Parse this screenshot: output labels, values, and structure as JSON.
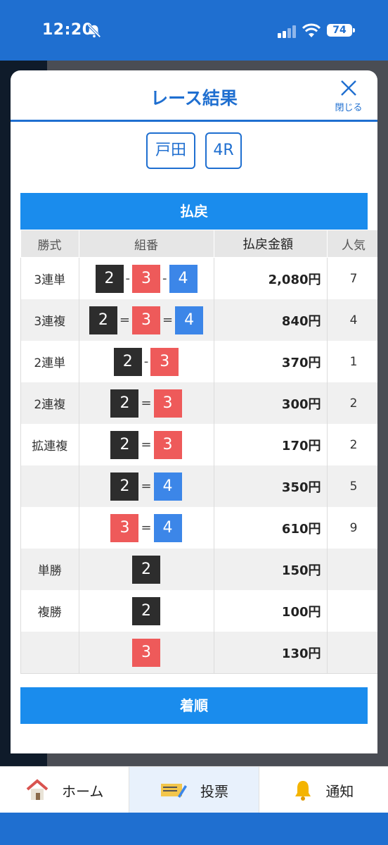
{
  "status": {
    "time": "12:20",
    "battery": "74"
  },
  "modal": {
    "title": "レース結果",
    "close_label": "閉じる",
    "venue": "戸田",
    "race": "4R",
    "payout_header": "払戻",
    "order_header": "着順"
  },
  "table": {
    "headers": [
      "勝式",
      "組番",
      "払戻金額",
      "人気"
    ],
    "rows": [
      {
        "bet": "3連単",
        "combo": [
          "2",
          "-",
          "3",
          "-",
          "4"
        ],
        "amount": "2,080円",
        "pop": "7"
      },
      {
        "bet": "3連複",
        "combo": [
          "2",
          "=",
          "3",
          "=",
          "4"
        ],
        "amount": "840円",
        "pop": "4"
      },
      {
        "bet": "2連単",
        "combo": [
          "2",
          "-",
          "3"
        ],
        "amount": "370円",
        "pop": "1"
      },
      {
        "bet": "2連複",
        "combo": [
          "2",
          "=",
          "3"
        ],
        "amount": "300円",
        "pop": "2"
      },
      {
        "bet": "拡連複",
        "combo": [
          "2",
          "=",
          "3"
        ],
        "amount": "170円",
        "pop": "2"
      },
      {
        "bet": "",
        "combo": [
          "2",
          "=",
          "4"
        ],
        "amount": "350円",
        "pop": "5"
      },
      {
        "bet": "",
        "combo": [
          "3",
          "=",
          "4"
        ],
        "amount": "610円",
        "pop": "9"
      },
      {
        "bet": "単勝",
        "combo": [
          "2"
        ],
        "amount": "150円",
        "pop": ""
      },
      {
        "bet": "複勝",
        "combo": [
          "2"
        ],
        "amount": "100円",
        "pop": ""
      },
      {
        "bet": "",
        "combo": [
          "3"
        ],
        "amount": "130円",
        "pop": ""
      }
    ]
  },
  "boat_colors": {
    "2": "#2d2d2d",
    "3": "#ee5a5a",
    "4": "#3c86e8"
  },
  "tabs": [
    {
      "label": "ホーム",
      "icon": "home-icon"
    },
    {
      "label": "投票",
      "icon": "ticket-icon"
    },
    {
      "label": "通知",
      "icon": "bell-icon"
    }
  ]
}
